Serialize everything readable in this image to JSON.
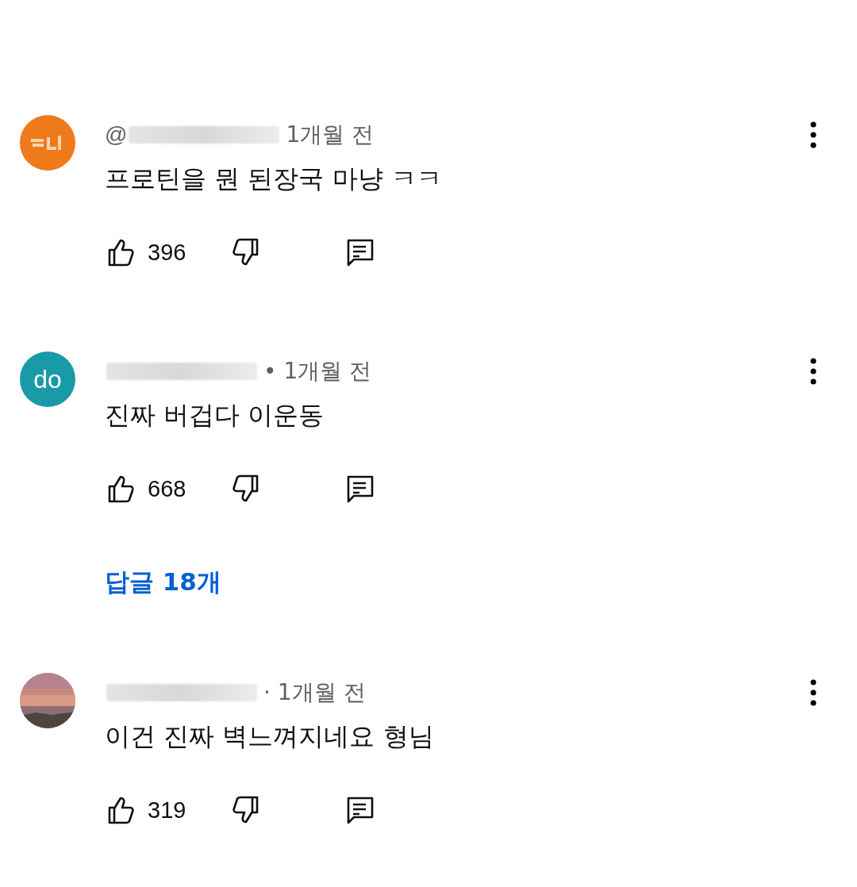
{
  "comments": [
    {
      "avatar": {
        "kind": "badge",
        "color": "#ef7a1a"
      },
      "username_visible": "@",
      "username_blurred": true,
      "time": "1개월 전",
      "text": "프로틴을 뭔 된장국 마냥 ㅋㅋ",
      "likes": "396"
    },
    {
      "avatar": {
        "kind": "initials",
        "color": "#1a9aa6",
        "initials": "do"
      },
      "username_blurred": true,
      "time": "• 1개월 전",
      "text": "진짜 버겁다 이운동",
      "likes": "668",
      "replies": "답글 18개"
    },
    {
      "username_blurred": true,
      "time": "· 1개월 전",
      "text": "이건 진짜 벽느껴지네요 형님",
      "likes": "319"
    }
  ]
}
